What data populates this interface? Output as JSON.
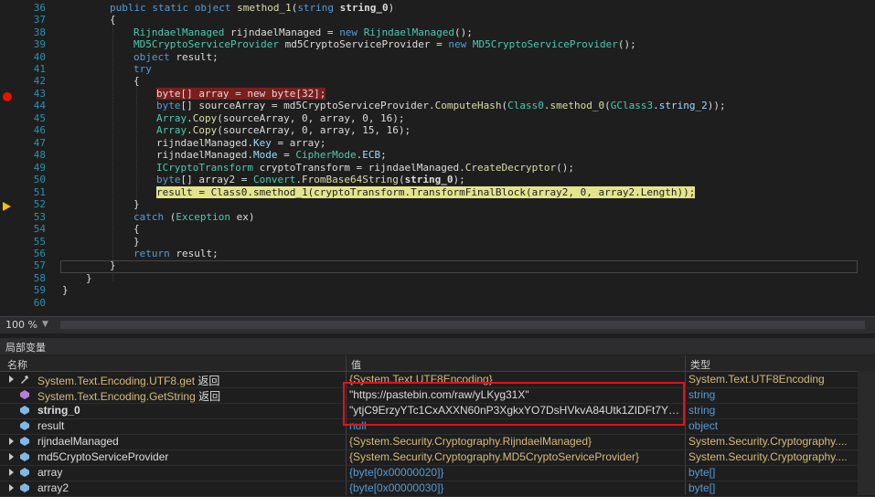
{
  "editor": {
    "lines": [
      {
        "num": "36",
        "text": "public static object smethod_1(string string_0)"
      },
      {
        "num": "37",
        "text": "{"
      },
      {
        "num": "38",
        "text": "RijndaelManaged rijndaelManaged = new RijndaelManaged();"
      },
      {
        "num": "39",
        "text": "MD5CryptoServiceProvider md5CryptoServiceProvider = new MD5CryptoServiceProvider();"
      },
      {
        "num": "40",
        "text": "object result;"
      },
      {
        "num": "41",
        "text": "try"
      },
      {
        "num": "42",
        "text": "{"
      },
      {
        "num": "43",
        "text": "byte[] array = new byte[32];"
      },
      {
        "num": "44",
        "text": "byte[] sourceArray = md5CryptoServiceProvider.ComputeHash(Class0.smethod_0(GClass3.string_2));"
      },
      {
        "num": "45",
        "text": "Array.Copy(sourceArray, 0, array, 0, 16);"
      },
      {
        "num": "46",
        "text": "Array.Copy(sourceArray, 0, array, 15, 16);"
      },
      {
        "num": "47",
        "text": "rijndaelManaged.Key = array;"
      },
      {
        "num": "48",
        "text": "rijndaelManaged.Mode = CipherMode.ECB;"
      },
      {
        "num": "49",
        "text": "ICryptoTransform cryptoTransform = rijndaelManaged.CreateDecryptor();"
      },
      {
        "num": "50",
        "text": "byte[] array2 = Convert.FromBase64String(string_0);"
      },
      {
        "num": "51",
        "text": "result = Class0.smethod_1(cryptoTransform.TransformFinalBlock(array2, 0, array2.Length));"
      },
      {
        "num": "52",
        "text": "}"
      },
      {
        "num": "53",
        "text": "catch (Exception ex)"
      },
      {
        "num": "54",
        "text": "{"
      },
      {
        "num": "55",
        "text": "}"
      },
      {
        "num": "56",
        "text": "return result;"
      },
      {
        "num": "57",
        "text": "}"
      },
      {
        "num": "58",
        "text": "}"
      },
      {
        "num": "59",
        "text": "}"
      },
      {
        "num": "60",
        "text": ""
      }
    ],
    "zoom": "100 %"
  },
  "locals": {
    "title": "局部变量",
    "headers": {
      "name": "名称",
      "value": "值",
      "type": "类型"
    },
    "rows": [
      {
        "name": "System.Text.Encoding.UTF8.get 返回",
        "value": "{System.Text.UTF8Encoding}",
        "type": "System.Text.UTF8Encoding",
        "icon": "return-value-icon"
      },
      {
        "name": "System.Text.Encoding.GetString 返回",
        "value": "\"https://pastebin.com/raw/yLKyg31X\"",
        "type": "string",
        "icon": "return-value-icon"
      },
      {
        "name": "string_0",
        "value": "\"ytjC9ErzyYTc1CxAXXN60nP3XgkxYO7DsHVkvA84Utk1ZIDFt7YDlX...\"",
        "type": "string",
        "icon": "variable-icon"
      },
      {
        "name": "result",
        "value": "null",
        "type": "object",
        "icon": "variable-icon"
      },
      {
        "name": "rijndaelManaged",
        "value": "{System.Security.Cryptography.RijndaelManaged}",
        "type": "System.Security.Cryptography....",
        "icon": "variable-icon"
      },
      {
        "name": "md5CryptoServiceProvider",
        "value": "{System.Security.Cryptography.MD5CryptoServiceProvider}",
        "type": "System.Security.Cryptography....",
        "icon": "variable-icon"
      },
      {
        "name": "array",
        "value": "{byte[0x00000020]}",
        "type": "byte[]",
        "icon": "variable-icon"
      },
      {
        "name": "array2",
        "value": "{byte[0x00000030]}",
        "type": "byte[]",
        "icon": "variable-icon"
      }
    ]
  },
  "colors": {
    "breakpoint": "#e51400",
    "current_statement": "#e4e48c",
    "highlight_box": "#e0121c"
  }
}
